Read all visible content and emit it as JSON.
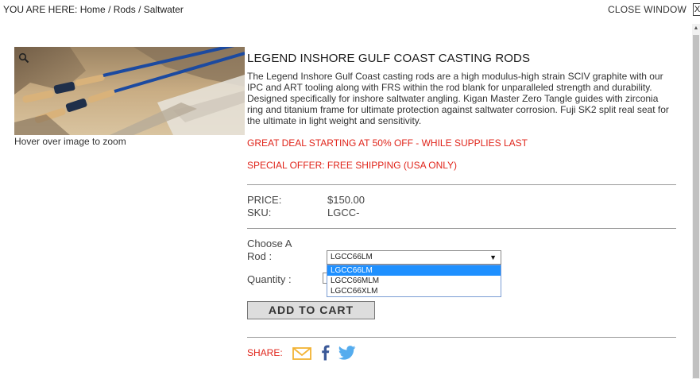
{
  "breadcrumb": {
    "prefix": "YOU ARE HERE:",
    "items": [
      "Home",
      "Rods",
      "Saltwater"
    ],
    "separator": "/"
  },
  "header": {
    "close_label": "CLOSE WINDOW",
    "close_x": "X"
  },
  "image": {
    "zoom_hint": "Hover over image to zoom",
    "zoom_icon": "magnifier-icon"
  },
  "product": {
    "title": "LEGEND INSHORE GULF COAST CASTING RODS",
    "description": "The Legend Inshore Gulf Coast casting rods are a high modulus-high strain SCIV graphite with our IPC and ART tooling along with FRS within the rod blank for unparalleled strength and durability. Designed specifically for inshore saltwater angling. Kigan Master Zero Tangle guides with zirconia ring and titanium frame for ultimate protection against saltwater corrosion. Fuji SK2 split real seat for the ultimate in light weight and sensitivity.",
    "promo_deal": "GREAT DEAL STARTING AT 50% OFF - WHILE SUPPLIES LAST",
    "promo_shipping": "SPECIAL OFFER: FREE SHIPPING (USA ONLY)",
    "price_label": "PRICE:",
    "price_value": "$150.00",
    "sku_label": "SKU:",
    "sku_value": "LGCC-"
  },
  "form": {
    "choose_label_1": "Choose A",
    "choose_label_2": "Rod :",
    "selected_rod": "LGCC66LM",
    "rod_options": [
      "LGCC66LM",
      "LGCC66MLM",
      "LGCC66XLM"
    ],
    "quantity_label": "Quantity :",
    "add_to_cart": "ADD TO CART"
  },
  "share": {
    "label": "SHARE:",
    "icons": [
      "email-icon",
      "facebook-icon",
      "twitter-icon"
    ]
  },
  "colors": {
    "accent_red": "#e0251b",
    "email_icon": "#f2b233",
    "facebook": "#3b5998",
    "twitter": "#55acee",
    "selected_option": "#1e90ff"
  }
}
